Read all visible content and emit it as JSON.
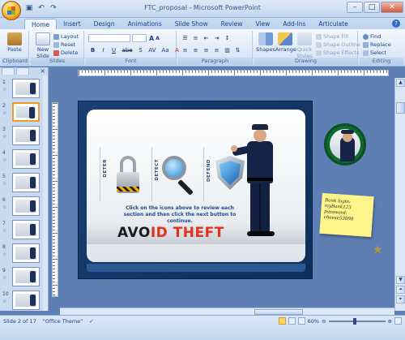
{
  "window": {
    "title": "FTC_proposal - Microsoft PowerPoint",
    "qat": [
      "save-icon",
      "undo-icon",
      "redo-icon"
    ],
    "controls": [
      "–",
      "□",
      "✕"
    ]
  },
  "tabs": [
    "Home",
    "Insert",
    "Design",
    "Animations",
    "Slide Show",
    "Review",
    "View",
    "Add-Ins",
    "Articulate"
  ],
  "ribbon": {
    "clipboard": {
      "paste": "Paste",
      "label": "Clipboard"
    },
    "slides": {
      "new_slide": "New Slide",
      "layout": "Layout",
      "reset": "Reset",
      "delete": "Delete",
      "label": "Slides"
    },
    "font": {
      "label": "Font",
      "bold": "B",
      "italic": "I",
      "underline": "U",
      "strike": "abe",
      "shadow": "S",
      "spacing": "AV",
      "case": "Aa",
      "grow": "A",
      "shrink": "A"
    },
    "paragraph": {
      "label": "Paragraph"
    },
    "drawing": {
      "shapes": "Shapes",
      "arrange": "Arrange",
      "quick_styles": "Quick Styles",
      "shape_fill": "Shape Fill",
      "shape_outline": "Shape Outline",
      "shape_effects": "Shape Effects",
      "label": "Drawing"
    },
    "editing": {
      "find": "Find",
      "replace": "Replace",
      "select": "Select",
      "label": "Editing"
    }
  },
  "thumbnails": [
    "1",
    "2",
    "3",
    "4",
    "5",
    "6",
    "7",
    "8",
    "9",
    "10"
  ],
  "selected_slide": 2,
  "slide": {
    "panels": [
      "DETER",
      "DETECT",
      "DEFEND"
    ],
    "instruction": "Click on the icons above to review each section and then click the next button to continue.",
    "brand_a": "AVO",
    "brand_b": "ID THEFT"
  },
  "sticky_note": {
    "line1": "Bank login: myBank123",
    "line2": "password: cheese53098"
  },
  "status": {
    "slide_info": "Slide 2 of 17",
    "theme": "\"Office Theme\"",
    "zoom": "60%"
  },
  "colors": {
    "accent": "#15428b",
    "selection": "#f29c2a",
    "brand_red": "#e3321c"
  }
}
